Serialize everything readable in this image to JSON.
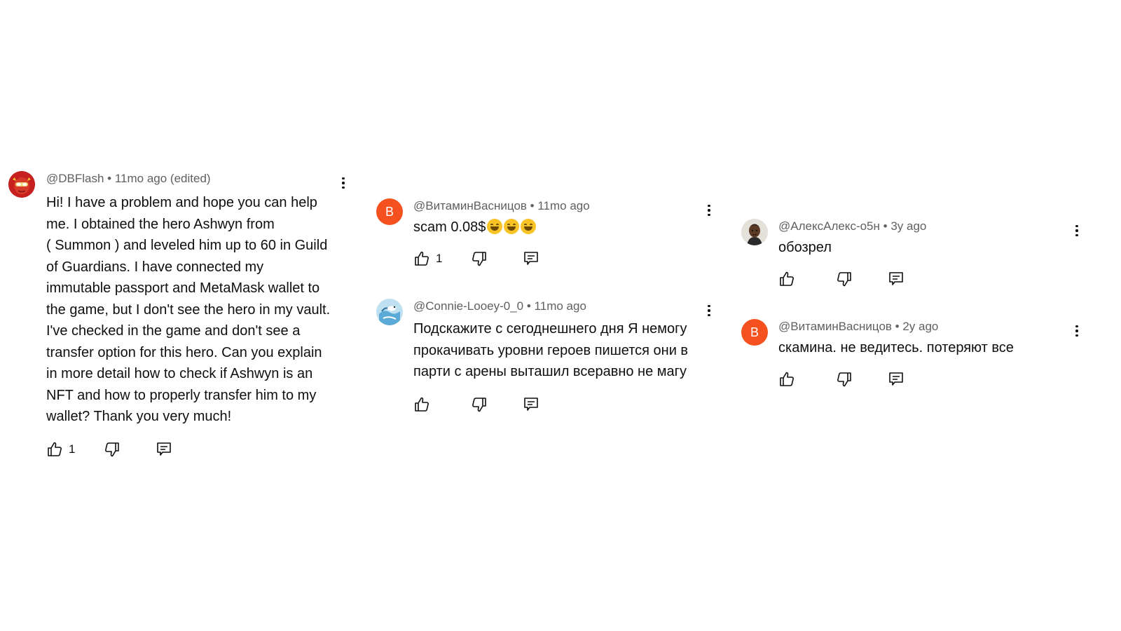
{
  "icons": {
    "like": "thumbs-up-icon",
    "dislike": "thumbs-down-icon",
    "reply": "reply-icon",
    "more": "more-vertical-icon"
  },
  "colors": {
    "letter_avatar_bg": "#f4511e",
    "meta_text": "#606060",
    "body_text": "#0f0f0f"
  },
  "comments": [
    {
      "author": "@DBFlash",
      "time": "11mo ago (edited)",
      "avatar": "flash-avatar",
      "lines": [
        "Hi! I have a problem and hope you can help",
        "me. I obtained the hero Ashwyn from",
        "( Summon ) and leveled him up to 60 in Guild",
        "of Guardians. I have connected my",
        "immutable passport and MetaMask wallet to",
        "the game, but I don't see the hero in my vault.",
        "I've checked in the game and don't see a",
        "transfer option for this hero. Can you explain",
        "in more detail how to check if Ashwyn is an",
        "NFT and how to properly transfer him to my",
        "wallet? Thank you very much!"
      ],
      "likes": "1"
    },
    {
      "author": "@ВитаминВасницов",
      "time": "11mo ago",
      "avatar_letter": "В",
      "text": "scam 0.08$",
      "emoji": "laughing-tears-emoji ×3",
      "likes": "1"
    },
    {
      "author": "@Connie-Looey-0_0",
      "time": "11mo ago",
      "avatar": "swan-avatar",
      "lines": [
        "Подскажите с сегоднешнего дня Я немогу",
        "прокачивать уровни героев пишется они в",
        "парти с арены выташил всеравно не магу"
      ],
      "likes": ""
    },
    {
      "author": "@АлексАлекс-о5н",
      "time": "3y ago",
      "avatar": "person-avatar",
      "text": "обозрел",
      "likes": ""
    },
    {
      "author": "@ВитаминВасницов",
      "time": "2y ago",
      "avatar_letter": "В",
      "text": "скамина. не ведитесь. потеряют все",
      "likes": ""
    }
  ],
  "separator": " • "
}
